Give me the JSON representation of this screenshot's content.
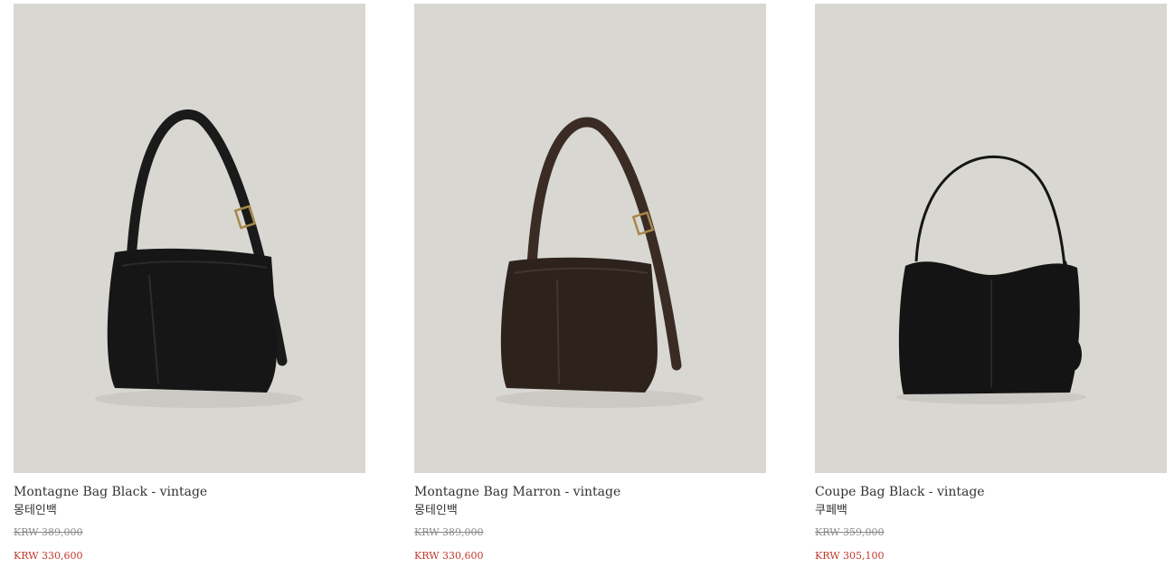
{
  "products": [
    {
      "name": "Montagne Bag Black - vintage",
      "korean_name": "몽테인백",
      "original_price": "KRW 389,000",
      "sale_price": "KRW 330,600",
      "image_icon": "shoulder-bag-black-icon",
      "bag_color": "#161616"
    },
    {
      "name": "Montagne Bag Marron - vintage",
      "korean_name": "몽테인백",
      "original_price": "KRW 389,000",
      "sale_price": "KRW 330,600",
      "image_icon": "shoulder-bag-brown-icon",
      "bag_color": "#2e221d"
    },
    {
      "name": "Coupe Bag Black - vintage",
      "korean_name": "쿠페백",
      "original_price": "KRW 359,000",
      "sale_price": "KRW 305,100",
      "image_icon": "hobo-bag-black-icon",
      "bag_color": "#141414"
    }
  ],
  "colors": {
    "image_background": "#d8d7d2",
    "sale_price": "#c0392b",
    "original_price": "#8a8a8a",
    "text": "#333333"
  }
}
